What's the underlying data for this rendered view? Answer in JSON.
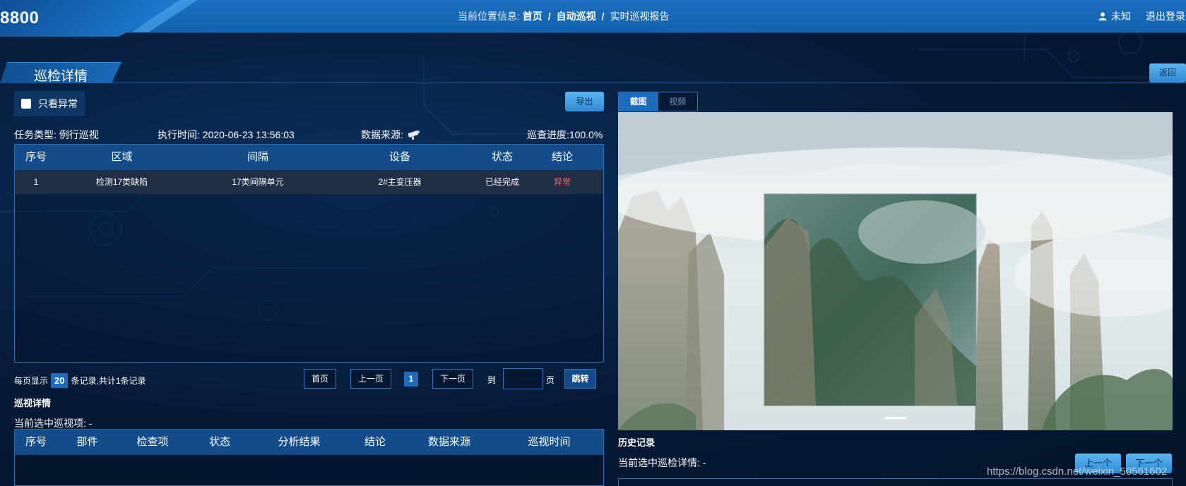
{
  "header": {
    "brand": "8800",
    "breadcrumb_prefix": "当前位置信息:",
    "breadcrumb": [
      "首页",
      "自动巡视",
      "实时巡视报告"
    ],
    "breadcrumb_sep": "/",
    "user_name": "未知",
    "logout_label": "退出登录"
  },
  "page": {
    "title": "巡检详情",
    "back_label": "返回"
  },
  "filter": {
    "only_abnormal_label": "只看异常",
    "checked": false,
    "export_label": "导出"
  },
  "task_info": {
    "task_type": "任务类型: 例行巡视",
    "exec_time": "执行时间: 2020-06-23 13:56:03",
    "data_source": "数据来源:",
    "progress": "巡查进度:100.0%"
  },
  "task_table": {
    "columns": [
      "序号",
      "区域",
      "间隔",
      "设备",
      "状态",
      "结论"
    ],
    "rows": [
      {
        "no": "1",
        "area": "检测17类缺陷",
        "interval": "17类间隔单元",
        "device": "2#主变压器",
        "status": "已经完成",
        "conclusion": "异常"
      }
    ]
  },
  "pagination": {
    "per_page_prefix": "每页显示",
    "per_page": "20",
    "per_page_suffix": "条记录,共计1条记录",
    "first_label": "首页",
    "prev_label": "上一页",
    "current_page": "1",
    "next_label": "下一页",
    "goto_prefix": "到",
    "goto_input": "",
    "goto_suffix": "页",
    "jump_label": "跳转"
  },
  "detail": {
    "title": "巡视详情",
    "selected_label": "当前选中巡视项: -",
    "columns": [
      "序号",
      "部件",
      "检查项",
      "状态",
      "分析结果",
      "结论",
      "数据来源",
      "巡视时间"
    ]
  },
  "viewer": {
    "tabs": [
      "截图",
      "视频"
    ],
    "active_tab": "截图"
  },
  "history": {
    "title": "历史记录",
    "selected_label": "当前选中巡检详情: -",
    "prev_label": "上一个",
    "next_label": "下一个"
  },
  "watermark": "https://blog.csdn.net/weixin_50561602",
  "colors": {
    "accent": "#1c6cbd",
    "header": "#1b6fbf",
    "table_head": "#124c8a",
    "abnormal": "#ff6666"
  }
}
